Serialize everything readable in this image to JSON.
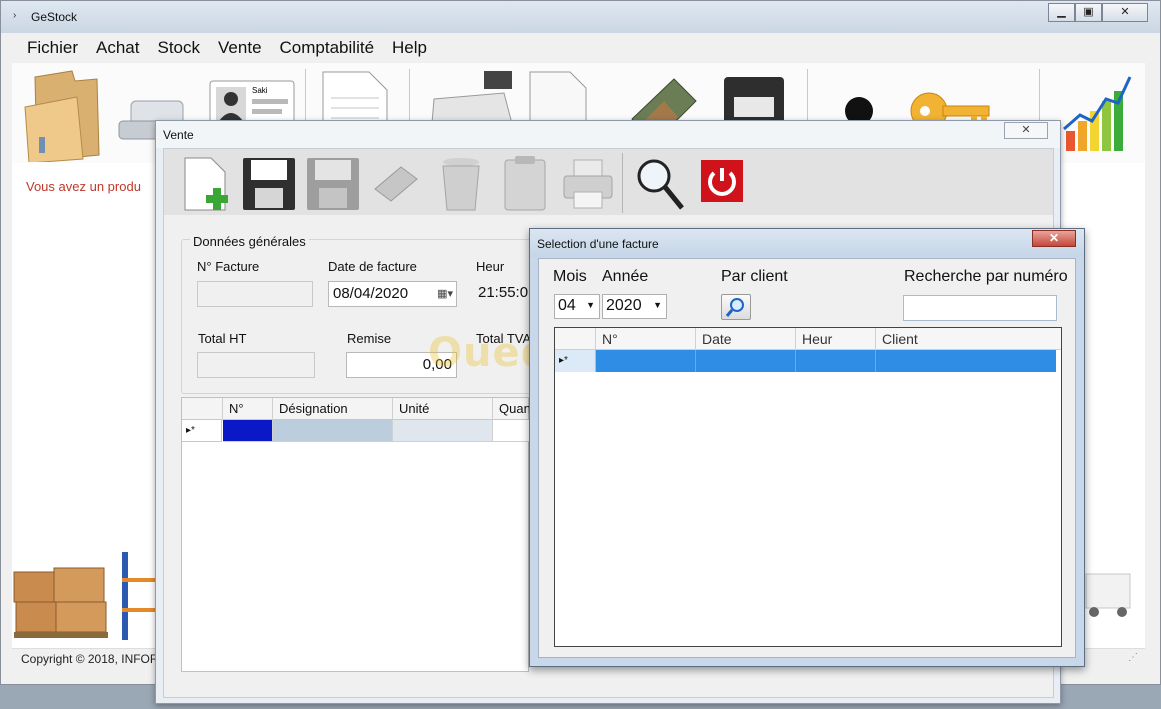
{
  "main_window": {
    "title": "GeStock",
    "menu": [
      "Fichier",
      "Achat",
      "Stock",
      "Vente",
      "Comptabilité",
      "Help"
    ],
    "toolbar_icons": [
      "folder-icon",
      "scanner-icon",
      "client-card-icon",
      "document-icon",
      "cash-register-icon",
      "new-document-icon",
      "money-icon",
      "safe-icon",
      "user-silhouette-icon",
      "key-icon",
      "growth-chart-icon"
    ],
    "card_name": "Saki",
    "notice": "Vous avez un produ",
    "copyright": "Copyright © 2018, INFOR"
  },
  "vente": {
    "title": "Vente",
    "toolbar_icons": [
      "new-icon",
      "save-icon",
      "save-disabled-icon",
      "money-icon",
      "trash-icon",
      "clipboard-icon",
      "print-icon",
      "search-icon",
      "power-icon"
    ],
    "group_title": "Données générales",
    "labels": {
      "facture": "N° Facture",
      "date": "Date de facture",
      "heure": "Heur",
      "total_ht": "Total HT",
      "remise": "Remise",
      "total_tva": "Total TVA"
    },
    "values": {
      "facture": "",
      "date": "08/04/2020",
      "heure": "21:55:0",
      "total_ht": "",
      "remise": "0,00"
    },
    "grid": {
      "columns": [
        "N°",
        "Désignation",
        "Unité",
        "Quan"
      ],
      "new_row_marker": "▸*"
    }
  },
  "selection": {
    "title": "Selection d'une facture",
    "labels": {
      "mois": "Mois",
      "annee": "Année",
      "par_client": "Par client",
      "recherche": "Recherche par numéro"
    },
    "mois_value": "04",
    "annee_value": "2020",
    "search_value": "",
    "grid": {
      "columns": [
        "N°",
        "Date",
        "Heur",
        "Client"
      ],
      "new_row_marker": "▸*"
    }
  },
  "watermark": "Ouedkniss.com",
  "colors": {
    "selection_row": "#2f8de6",
    "close_red": "#c6473a",
    "notice_red": "#c0392b",
    "power_red": "#d0121b"
  }
}
